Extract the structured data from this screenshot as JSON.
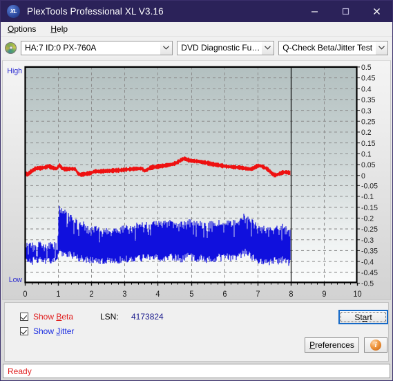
{
  "window": {
    "title": "PlexTools Professional XL V3.16",
    "app_icon": "xl-logo-icon",
    "minimize_label": "Minimize",
    "maximize_label": "Maximize",
    "close_label": "Close"
  },
  "menu": {
    "items": [
      {
        "label": "Options",
        "accel": "O"
      },
      {
        "label": "Help",
        "accel": "H"
      }
    ]
  },
  "toolbar": {
    "drive_icon": "optical-disc-icon",
    "drive_select": "HA:7 ID:0  PX-760A",
    "function_select": "DVD Diagnostic Functions",
    "test_select": "Q-Check Beta/Jitter Test"
  },
  "chart_axis": {
    "high_label": "High",
    "low_label": "Low",
    "y_ticks": [
      "0.5",
      "0.45",
      "0.4",
      "0.35",
      "0.3",
      "0.25",
      "0.2",
      "0.15",
      "0.1",
      "0.05",
      "0",
      "-0.05",
      "-0.1",
      "-0.15",
      "-0.2",
      "-0.25",
      "-0.3",
      "-0.35",
      "-0.4",
      "-0.45",
      "-0.5"
    ],
    "x_ticks": [
      "0",
      "1",
      "2",
      "3",
      "4",
      "5",
      "6",
      "7",
      "8",
      "9",
      "10"
    ]
  },
  "controls": {
    "show_beta": {
      "label_pre": "Show ",
      "accel": "B",
      "label_post": "eta",
      "checked": true,
      "color": "#e02020"
    },
    "show_jitter": {
      "label_pre": "Show ",
      "accel": "J",
      "label_post": "itter",
      "checked": true,
      "color": "#1a2ce0"
    },
    "lsn_label": "LSN:",
    "lsn_value": "4173824",
    "start_button": {
      "pre": "St",
      "accel": "a",
      "post": "rt"
    },
    "preferences_button": {
      "pre": "",
      "accel": "P",
      "post": "references"
    },
    "info_button": {
      "icon": "info-icon",
      "glyph": "i"
    }
  },
  "status": {
    "text": "Ready"
  },
  "chart_data": {
    "type": "line",
    "title": "Q-Check Beta/Jitter Test",
    "xlabel": "",
    "ylabel": "",
    "xlim": [
      0,
      10
    ],
    "ylim": [
      -0.5,
      0.5
    ],
    "grid": true,
    "legend": "checkbox-toggles",
    "data_end_x": 8,
    "y_tick_step": 0.05,
    "x_tick_step": 1,
    "series": [
      {
        "name": "Beta",
        "color": "#ee1111",
        "type": "line",
        "x": [
          0.0,
          0.08,
          0.16,
          0.24,
          0.32,
          0.4,
          0.48,
          0.56,
          0.64,
          0.72,
          0.8,
          0.88,
          0.96,
          1.04,
          1.12,
          1.2,
          1.28,
          1.36,
          1.44,
          1.52,
          1.6,
          1.68,
          1.76,
          1.84,
          1.92,
          2.0,
          2.08,
          2.16,
          2.24,
          2.32,
          2.4,
          2.48,
          2.56,
          2.64,
          2.72,
          2.8,
          2.88,
          2.96,
          3.04,
          3.12,
          3.2,
          3.28,
          3.36,
          3.44,
          3.52,
          3.6,
          3.68,
          3.76,
          3.84,
          3.92,
          4.0,
          4.08,
          4.16,
          4.24,
          4.32,
          4.4,
          4.48,
          4.56,
          4.64,
          4.72,
          4.8,
          4.88,
          4.96,
          5.04,
          5.12,
          5.2,
          5.28,
          5.36,
          5.44,
          5.52,
          5.6,
          5.68,
          5.76,
          5.84,
          5.92,
          6.0,
          6.08,
          6.16,
          6.24,
          6.32,
          6.4,
          6.48,
          6.56,
          6.64,
          6.72,
          6.8,
          6.88,
          6.96,
          7.04,
          7.12,
          7.2,
          7.28,
          7.36,
          7.44,
          7.52,
          7.6,
          7.68,
          7.76,
          7.84,
          7.92,
          8.0
        ],
        "y": [
          0.01,
          0.0,
          0.012,
          0.02,
          0.028,
          0.031,
          0.03,
          0.033,
          0.035,
          0.04,
          0.034,
          0.03,
          0.028,
          0.044,
          0.03,
          0.026,
          0.026,
          0.027,
          0.027,
          0.026,
          0.005,
          0.0,
          0.002,
          0.004,
          0.006,
          0.008,
          0.015,
          0.016,
          0.015,
          0.016,
          0.017,
          0.018,
          0.018,
          0.019,
          0.02,
          0.02,
          0.021,
          0.022,
          0.024,
          0.025,
          0.026,
          0.027,
          0.028,
          0.028,
          0.029,
          0.018,
          0.022,
          0.031,
          0.034,
          0.036,
          0.038,
          0.04,
          0.041,
          0.043,
          0.045,
          0.047,
          0.05,
          0.055,
          0.062,
          0.07,
          0.075,
          0.07,
          0.066,
          0.064,
          0.063,
          0.062,
          0.06,
          0.058,
          0.056,
          0.053,
          0.05,
          0.048,
          0.046,
          0.044,
          0.042,
          0.04,
          0.038,
          0.037,
          0.036,
          0.035,
          0.034,
          0.033,
          0.031,
          0.029,
          0.027,
          0.026,
          0.03,
          0.038,
          0.042,
          0.04,
          0.034,
          0.028,
          0.018,
          0.005,
          -0.002,
          0.0,
          0.006,
          0.01,
          0.012,
          0.01,
          0.008
        ],
        "noise_amplitude": 0.008
      },
      {
        "name": "Jitter",
        "color": "#1111dd",
        "type": "band",
        "x": [
          0.0,
          0.08,
          0.16,
          0.24,
          0.32,
          0.4,
          0.48,
          0.56,
          0.64,
          0.72,
          0.8,
          0.88,
          0.96,
          1.04,
          1.12,
          1.2,
          1.28,
          1.36,
          1.44,
          1.52,
          1.6,
          1.68,
          1.76,
          1.84,
          1.92,
          2.0,
          2.08,
          2.16,
          2.24,
          2.32,
          2.4,
          2.48,
          2.56,
          2.64,
          2.72,
          2.8,
          2.88,
          2.96,
          3.04,
          3.12,
          3.2,
          3.28,
          3.36,
          3.44,
          3.52,
          3.6,
          3.68,
          3.76,
          3.84,
          3.92,
          4.0,
          4.08,
          4.16,
          4.24,
          4.32,
          4.4,
          4.48,
          4.56,
          4.64,
          4.72,
          4.8,
          4.88,
          4.96,
          5.04,
          5.12,
          5.2,
          5.28,
          5.36,
          5.44,
          5.52,
          5.6,
          5.68,
          5.76,
          5.84,
          5.92,
          6.0,
          6.08,
          6.16,
          6.24,
          6.32,
          6.4,
          6.48,
          6.56,
          6.64,
          6.72,
          6.8,
          6.88,
          6.96,
          7.04,
          7.12,
          7.2,
          7.28,
          7.36,
          7.44,
          7.52,
          7.6,
          7.68,
          7.76,
          7.84,
          7.92,
          8.0
        ],
        "y_top": [
          -0.325,
          -0.33,
          -0.322,
          -0.328,
          -0.32,
          -0.33,
          -0.325,
          -0.332,
          -0.327,
          -0.324,
          -0.33,
          -0.326,
          -0.32,
          -0.15,
          -0.175,
          -0.15,
          -0.2,
          -0.19,
          -0.205,
          -0.215,
          -0.23,
          -0.24,
          -0.235,
          -0.245,
          -0.25,
          -0.255,
          -0.25,
          -0.258,
          -0.262,
          -0.255,
          -0.265,
          -0.26,
          -0.268,
          -0.265,
          -0.258,
          -0.262,
          -0.255,
          -0.25,
          -0.245,
          -0.252,
          -0.248,
          -0.24,
          -0.238,
          -0.242,
          -0.235,
          -0.232,
          -0.228,
          -0.235,
          -0.24,
          -0.23,
          -0.225,
          -0.232,
          -0.228,
          -0.222,
          -0.23,
          -0.225,
          -0.22,
          -0.228,
          -0.232,
          -0.235,
          -0.228,
          -0.222,
          -0.218,
          -0.225,
          -0.23,
          -0.235,
          -0.23,
          -0.238,
          -0.242,
          -0.235,
          -0.23,
          -0.238,
          -0.232,
          -0.225,
          -0.23,
          -0.225,
          -0.22,
          -0.228,
          -0.23,
          -0.225,
          -0.218,
          -0.21,
          -0.2,
          -0.195,
          -0.205,
          -0.215,
          -0.225,
          -0.235,
          -0.245,
          -0.255,
          -0.25,
          -0.258,
          -0.262,
          -0.255,
          -0.25,
          -0.255,
          -0.248,
          -0.242,
          -0.25,
          -0.258,
          -0.262
        ],
        "y_bottom": [
          -0.395,
          -0.4,
          -0.392,
          -0.398,
          -0.39,
          -0.4,
          -0.395,
          -0.402,
          -0.397,
          -0.394,
          -0.4,
          -0.396,
          -0.39,
          -0.35,
          -0.36,
          -0.352,
          -0.37,
          -0.365,
          -0.372,
          -0.378,
          -0.382,
          -0.388,
          -0.385,
          -0.39,
          -0.392,
          -0.395,
          -0.392,
          -0.396,
          -0.398,
          -0.394,
          -0.398,
          -0.396,
          -0.4,
          -0.398,
          -0.394,
          -0.396,
          -0.392,
          -0.39,
          -0.388,
          -0.392,
          -0.39,
          -0.386,
          -0.385,
          -0.388,
          -0.384,
          -0.382,
          -0.38,
          -0.384,
          -0.388,
          -0.382,
          -0.378,
          -0.384,
          -0.382,
          -0.378,
          -0.384,
          -0.38,
          -0.376,
          -0.382,
          -0.386,
          -0.388,
          -0.382,
          -0.378,
          -0.376,
          -0.38,
          -0.384,
          -0.388,
          -0.384,
          -0.39,
          -0.392,
          -0.388,
          -0.384,
          -0.39,
          -0.386,
          -0.38,
          -0.384,
          -0.38,
          -0.376,
          -0.382,
          -0.384,
          -0.38,
          -0.374,
          -0.368,
          -0.362,
          -0.358,
          -0.366,
          -0.374,
          -0.382,
          -0.39,
          -0.396,
          -0.402,
          -0.398,
          -0.404,
          -0.406,
          -0.4,
          -0.396,
          -0.4,
          -0.394,
          -0.39,
          -0.396,
          -0.402,
          -0.406
        ],
        "spike_amplitude": 0.06
      }
    ]
  }
}
